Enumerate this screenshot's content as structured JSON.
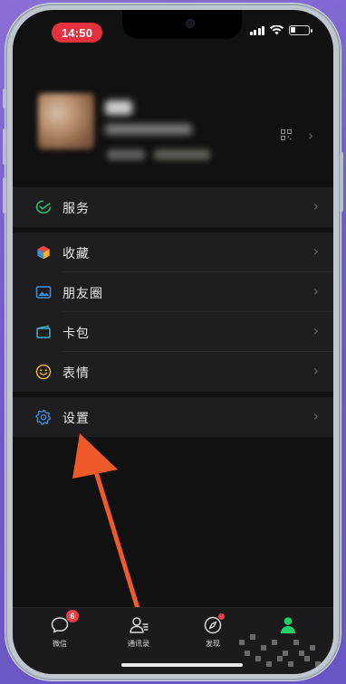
{
  "status_bar": {
    "time": "14:50"
  },
  "profile": {
    "has_qr_code": true
  },
  "menu": {
    "services": {
      "label": "服务",
      "icon": "wechat-pay-icon",
      "color": "#2fbd6e"
    },
    "favorites": {
      "label": "收藏",
      "icon": "cube-icon"
    },
    "moments": {
      "label": "朋友圈",
      "icon": "picture-icon",
      "color": "#3f8fd8"
    },
    "cards": {
      "label": "卡包",
      "icon": "card-wallet-icon",
      "color": "#40b3c8"
    },
    "stickers": {
      "label": "表情",
      "icon": "smiley-icon",
      "color": "#e6b127"
    },
    "settings": {
      "label": "设置",
      "icon": "gear-icon",
      "color": "#3f8fd8"
    }
  },
  "tabbar": {
    "chats": {
      "label": "微信",
      "badge": "6",
      "icon": "chat-bubble-icon"
    },
    "contacts": {
      "label": "通讯录",
      "icon": "contacts-icon"
    },
    "discover": {
      "label": "发现",
      "icon": "compass-icon",
      "has_dot": true
    },
    "me": {
      "label": "",
      "icon": "person-icon",
      "active_color": "#1fd36a"
    }
  },
  "annotation": {
    "type": "arrow",
    "color": "#ef5a2a",
    "points_to": "settings"
  }
}
